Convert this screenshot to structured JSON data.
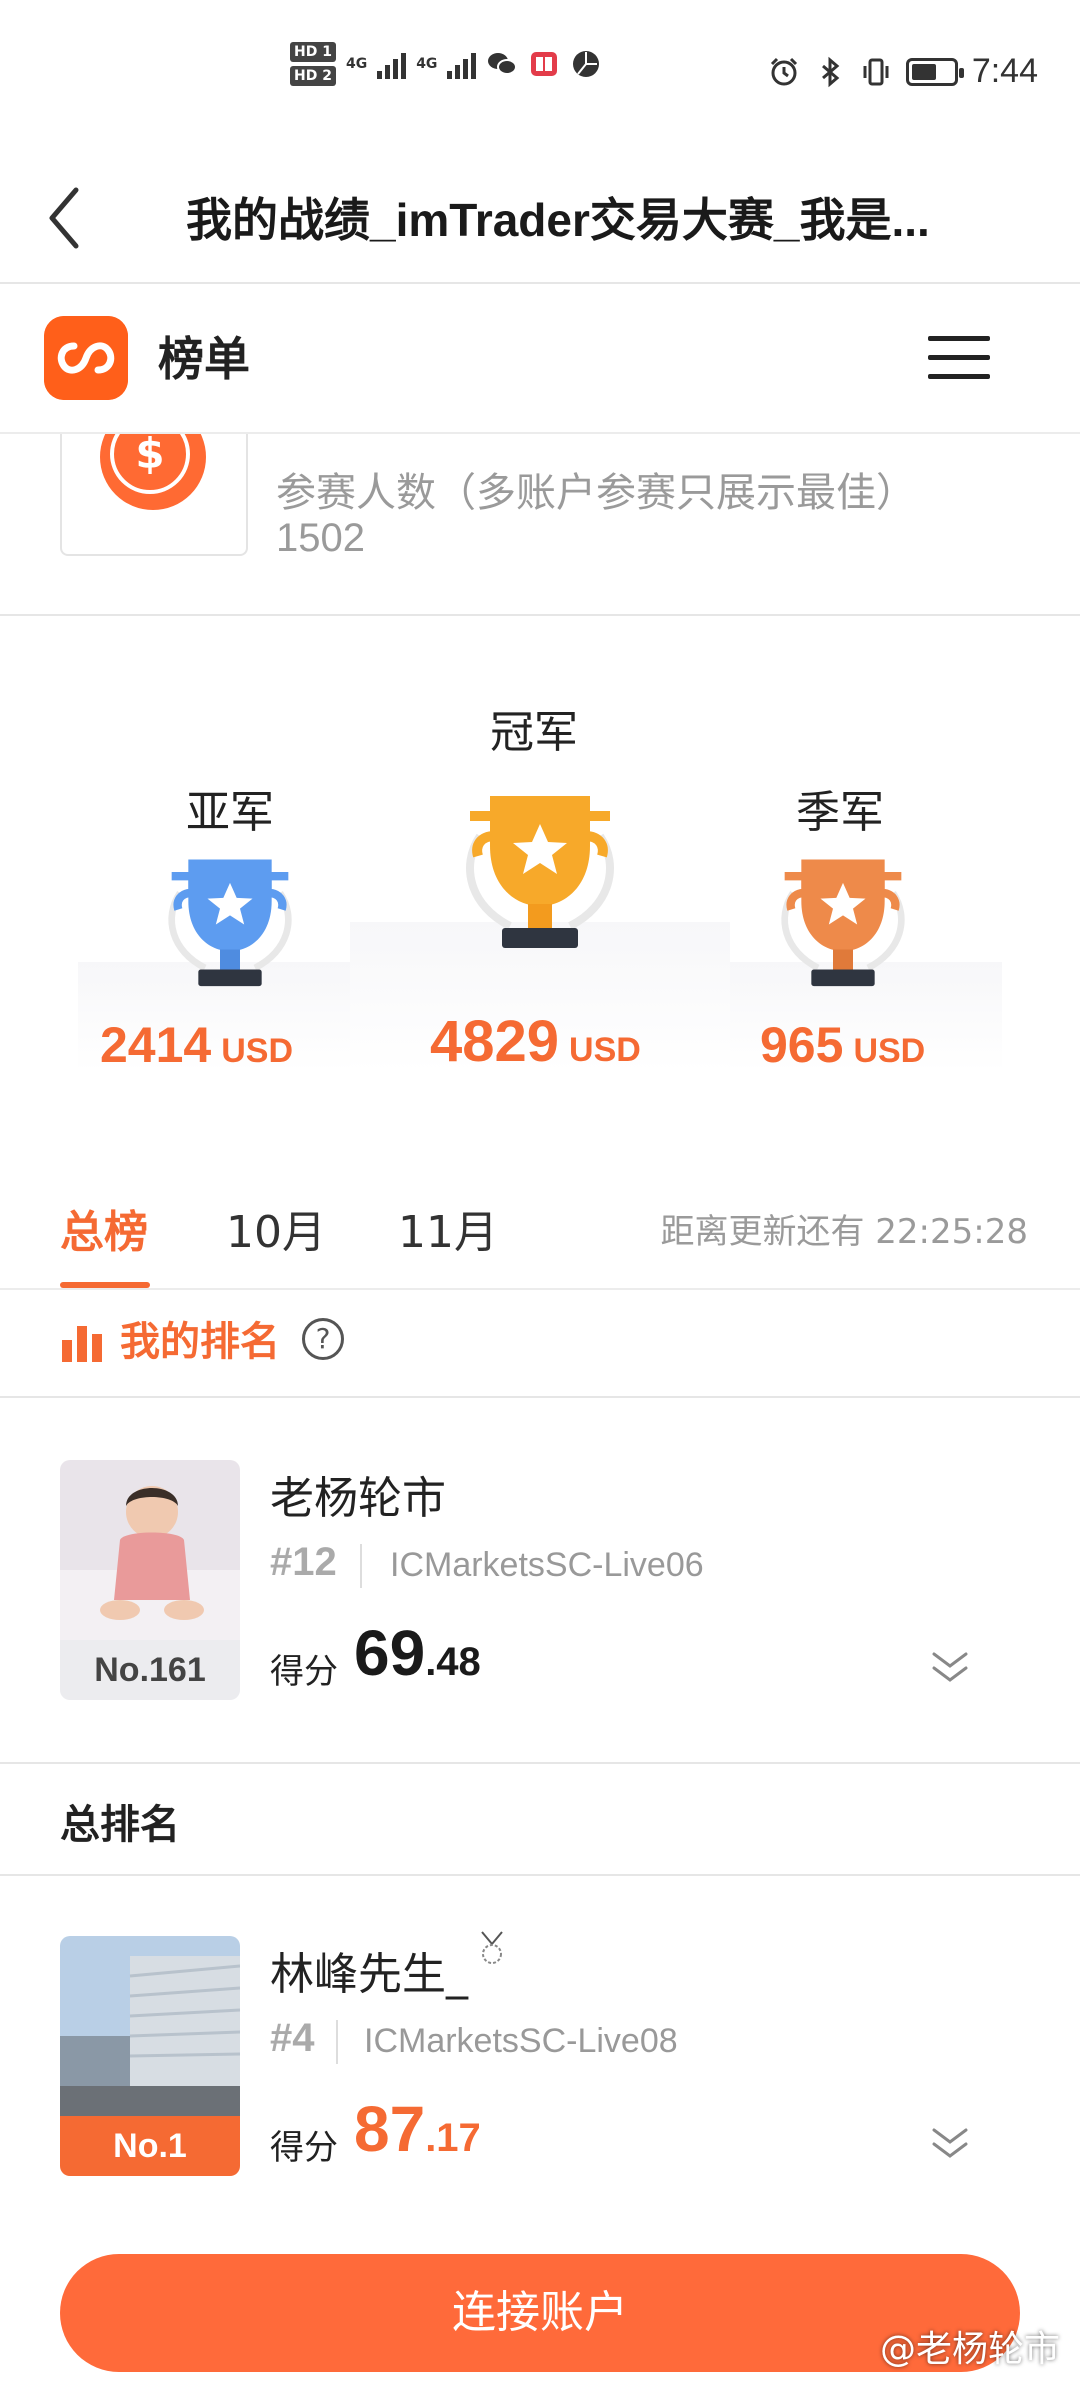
{
  "status_bar": {
    "time": "7:44",
    "hd1": "HD 1",
    "hd2": "HD 2",
    "net1": "4G",
    "net2": "4G",
    "icons": [
      "wechat-icon",
      "book-icon",
      "pinwheel-icon",
      "alarm-icon",
      "bluetooth-icon",
      "vibrate-icon",
      "battery-icon"
    ],
    "battery_level": 0.6
  },
  "titlebar": {
    "title": "我的战绩_imTrader交易大赛_我是..."
  },
  "app_header": {
    "name": "榜单"
  },
  "participants": {
    "label": "参赛人数（多账户参赛只展示最佳）",
    "count": "1502"
  },
  "podium": {
    "first": {
      "title": "冠军",
      "amount": "4829",
      "unit": "USD"
    },
    "second": {
      "title": "亚军",
      "amount": "2414",
      "unit": "USD"
    },
    "third": {
      "title": "季军",
      "amount": "965",
      "unit": "USD"
    }
  },
  "tabs": [
    {
      "label": "总榜",
      "active": true
    },
    {
      "label": "10月",
      "active": false
    },
    {
      "label": "11月",
      "active": false
    }
  ],
  "countdown": "距离更新还有 22:25:28",
  "my_rank": {
    "header": "我的排名",
    "help": "?",
    "user": {
      "name": "老杨轮市",
      "rank": "#12",
      "server": "ICMarketsSC-Live06",
      "score_label": "得分",
      "score_int": "69",
      "score_dec": ".48",
      "badge": "No.161"
    }
  },
  "total": {
    "header": "总排名",
    "entries": [
      {
        "name": "林峰先生_",
        "rank": "#4",
        "server": "ICMarketsSC-Live08",
        "score_label": "得分",
        "score_int": "87",
        "score_dec": ".17",
        "badge": "No.1"
      }
    ]
  },
  "bottom": {
    "connect_label": "连接账户",
    "watermark": "@老杨轮市"
  },
  "colors": {
    "accent": "#f56a33",
    "gold": "#f7a92a",
    "silver": "#5d9cf0",
    "bronze": "#ee8a4a"
  }
}
